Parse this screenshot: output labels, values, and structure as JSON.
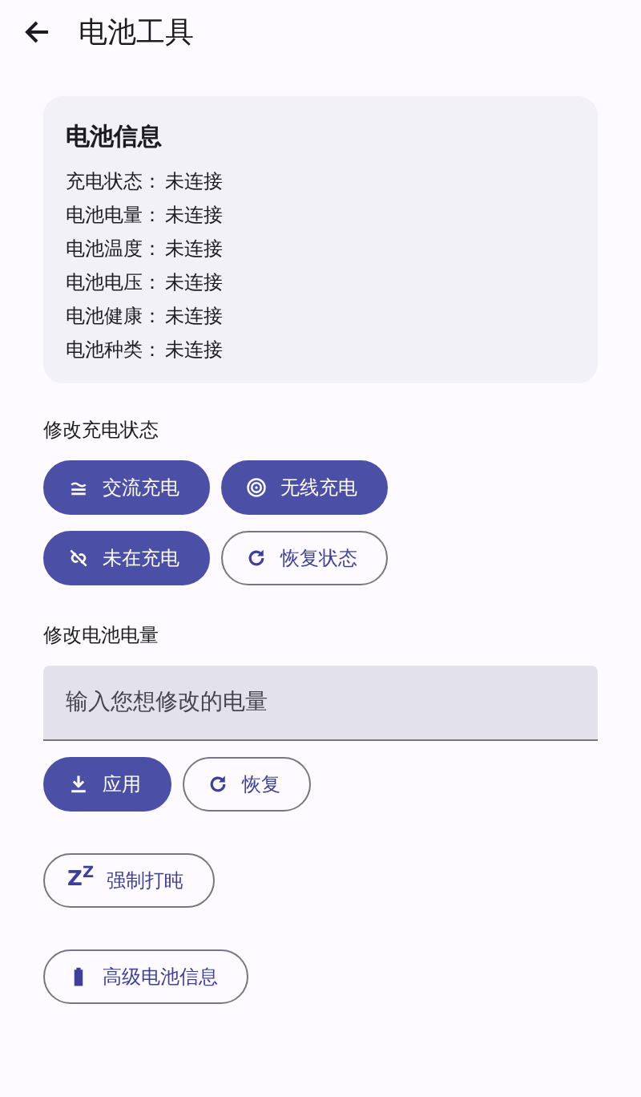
{
  "header": {
    "title": "电池工具"
  },
  "battery_info": {
    "title": "电池信息",
    "rows": [
      {
        "label": "充电状态：",
        "value": "未连接"
      },
      {
        "label": "电池电量：",
        "value": "未连接"
      },
      {
        "label": "电池温度：",
        "value": "未连接"
      },
      {
        "label": "电池电压：",
        "value": "未连接"
      },
      {
        "label": "电池健康：",
        "value": "未连接"
      },
      {
        "label": "电池种类：",
        "value": "未连接"
      }
    ]
  },
  "charge_section": {
    "label": "修改充电状态",
    "buttons": [
      {
        "label": "交流充电",
        "kind": "filled"
      },
      {
        "label": "无线充电",
        "kind": "filled"
      },
      {
        "label": "未在充电",
        "kind": "filled"
      },
      {
        "label": "恢复状态",
        "kind": "outlined"
      }
    ]
  },
  "level_section": {
    "label": "修改电池电量",
    "input": {
      "placeholder": "输入您想修改的电量"
    },
    "buttons": [
      {
        "label": "应用",
        "kind": "filled"
      },
      {
        "label": "恢复",
        "kind": "outlined"
      }
    ]
  },
  "doze_button": {
    "label": "强制打盹",
    "kind": "outlined",
    "icon_text": "Z$^{Z}$"
  },
  "advanced_button": {
    "label": "高级电池信息",
    "kind": "outlined"
  }
}
